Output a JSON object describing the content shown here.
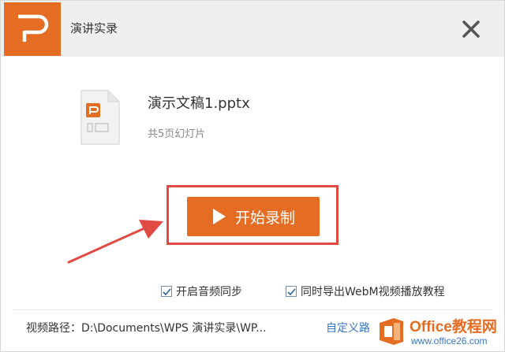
{
  "window": {
    "title": "演讲实录"
  },
  "file": {
    "name": "演示文稿1.pptx",
    "slide_count": "共5页幻灯片"
  },
  "actions": {
    "record_label": "开始录制"
  },
  "options": [
    {
      "label": "开启音频同步",
      "checked": true
    },
    {
      "label": "同时导出WebM视频播放教程",
      "checked": true
    }
  ],
  "footer": {
    "path_text": "视频路径：D:\\Documents\\WPS 演讲实录\\WP...",
    "custom_path_label": "自定义路"
  },
  "watermark": {
    "title": "Office教程网",
    "url": "www.office26.com"
  },
  "colors": {
    "accent": "#e46c23",
    "highlight": "#e14a43",
    "link": "#3a75c4"
  },
  "icons": {
    "app": "wps-presentation-logo-icon",
    "close": "close-icon",
    "file": "pptx-file-icon",
    "play": "play-icon",
    "checkbox": "checkmark-icon",
    "annotation": "red-arrow-annotation"
  }
}
